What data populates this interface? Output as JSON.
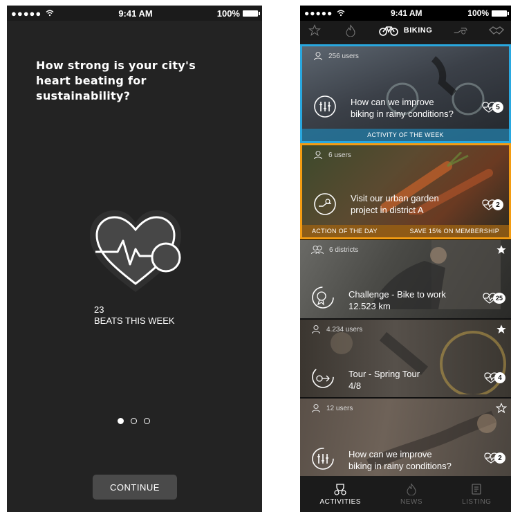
{
  "status": {
    "time": "9:41 AM",
    "battery": "100%"
  },
  "onboarding": {
    "headline": "How strong is your city's\nheart beating for sustainability?",
    "beats_count": "23",
    "beats_label": "BEATS THIS WEEK",
    "continue_label": "CONTINUE",
    "pager": {
      "pages": 3,
      "active": 0
    }
  },
  "feed": {
    "nav_active_label": "BIKING",
    "cards": [
      {
        "meta": "256 users",
        "title": "How can we improve\nbiking in rainy conditions?",
        "likes": "5",
        "footer_center": "ACTIVITY OF THE  WEEK"
      },
      {
        "meta": "6 users",
        "title": "Visit our urban garden\nproject in district A",
        "likes": "2",
        "footer_left": "ACTION OF THE  DAY",
        "footer_right": "SAVE 15% ON MEMBERSHIP"
      },
      {
        "meta": "6 districts",
        "title": "Challenge - Bike to work\n12.523 km",
        "likes": "25"
      },
      {
        "meta": "4.234 users",
        "title": "Tour - Spring Tour\n4/8",
        "likes": "4"
      },
      {
        "meta": "12 users",
        "title": "How can we improve\nbiking in rainy conditions?",
        "likes": "2"
      }
    ],
    "tabs": [
      {
        "label": "ACTIVITIES"
      },
      {
        "label": "NEWS"
      },
      {
        "label": "LISTING"
      }
    ]
  },
  "colors": {
    "highlight_blue": "#29a8e0",
    "highlight_orange": "#f39c12"
  }
}
